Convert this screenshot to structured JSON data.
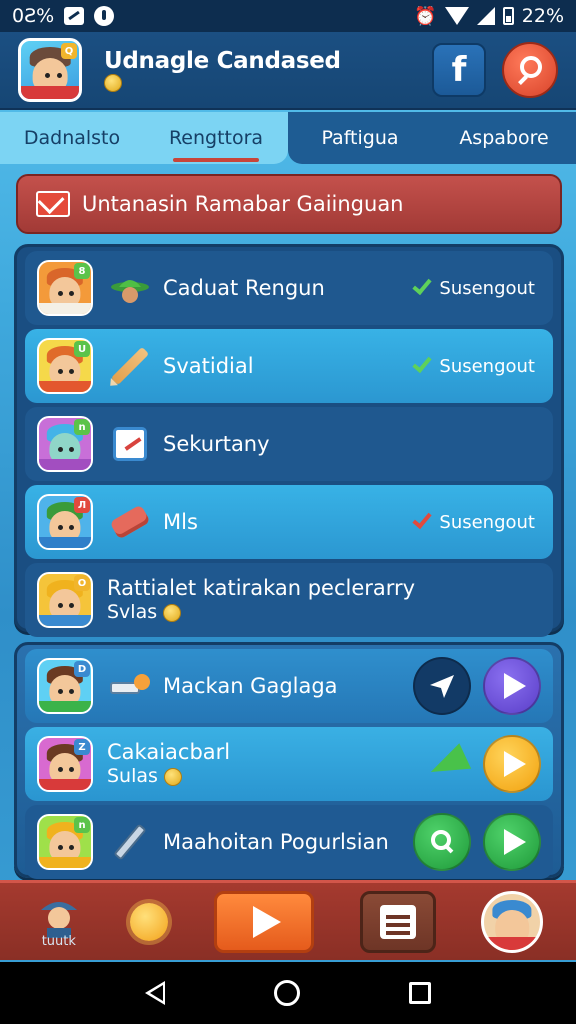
{
  "status_bar": {
    "left_text": "0Ƨ%",
    "battery": "22%",
    "icons": [
      "image-icon",
      "record-icon",
      "alarm-icon",
      "wifi-icon",
      "signal-icon",
      "battery-icon"
    ]
  },
  "header": {
    "title": "Udnagle Candased",
    "facebook_glyph": "f"
  },
  "tabs": [
    {
      "label": "Dadnalsto"
    },
    {
      "label": "Rengttora"
    },
    {
      "label": "Paftigua"
    },
    {
      "label": "Aspabore"
    }
  ],
  "banner": {
    "text": "Untanasin Ramabar Gaiinguan"
  },
  "panel1": {
    "rows": [
      {
        "label": "Caduat Rengun",
        "status": "Susengout",
        "icon": "hat-icon"
      },
      {
        "label": "Svatidial",
        "status": "Susengout",
        "icon": "pencil-icon"
      },
      {
        "label": "Sekurtany",
        "status": "",
        "icon": "notepad-icon"
      },
      {
        "label": "Mls",
        "status": "Susengout",
        "icon": "candy-icon"
      },
      {
        "label": "Rattialet katirakan peclerarry",
        "sub": "Svlas"
      }
    ]
  },
  "panel2": {
    "rows": [
      {
        "label": "Mackan Gaglaga"
      },
      {
        "label": "Cakaiacbarl",
        "sub": "Sulas"
      },
      {
        "label": "Maahoitan Pogurlsian"
      }
    ]
  },
  "bottom_bar": {
    "profile_label": "tuutk"
  },
  "colors": {
    "accent": "#2f8fc9",
    "banner": "#b2443f",
    "bottom": "#9a352a",
    "play_orange": "#f07a2c",
    "play_purple": "#6a4fd6",
    "play_yellow": "#ffb21a",
    "play_green": "#2db54a"
  }
}
